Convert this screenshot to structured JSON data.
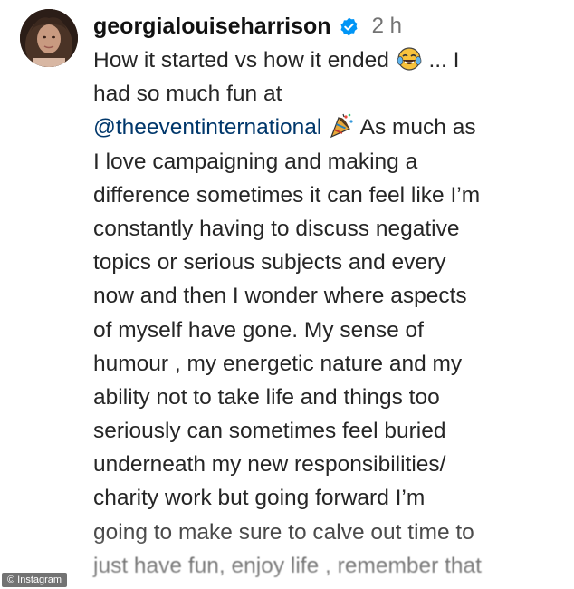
{
  "post": {
    "username": "georgialouiseharrison",
    "time_ago": "2 h",
    "caption_lines": [
      {
        "text_before": "How it started vs how it ended ",
        "emoji": "tears-of-joy-emoji",
        "text_after": " ... I"
      },
      {
        "text": "had so much fun at"
      },
      {
        "mention": "@theeventinternational",
        "emoji": "party-popper-emoji",
        "text_after": " As much as"
      },
      {
        "text": "I love campaigning and making a"
      },
      {
        "text": "difference sometimes it can feel like I’m"
      },
      {
        "text": "constantly having to discuss negative"
      },
      {
        "text": "topics or serious subjects and every"
      },
      {
        "text": "now and then I wonder where aspects"
      },
      {
        "text": "of myself have gone. My sense of"
      },
      {
        "text": "humour , my energetic nature and my"
      },
      {
        "text": "ability not to take life and things too"
      },
      {
        "text": "seriously can sometimes feel buried"
      },
      {
        "text": "underneath my new responsibilities/"
      },
      {
        "text": "charity work but going forward I’m"
      },
      {
        "text": "going to make sure to calve out time to"
      },
      {
        "text": "just have fun, enjoy life , remember that"
      }
    ]
  },
  "watermark": "© Instagram",
  "colors": {
    "mention": "#00376b",
    "verified": "#0095f6",
    "time": "#737373"
  }
}
